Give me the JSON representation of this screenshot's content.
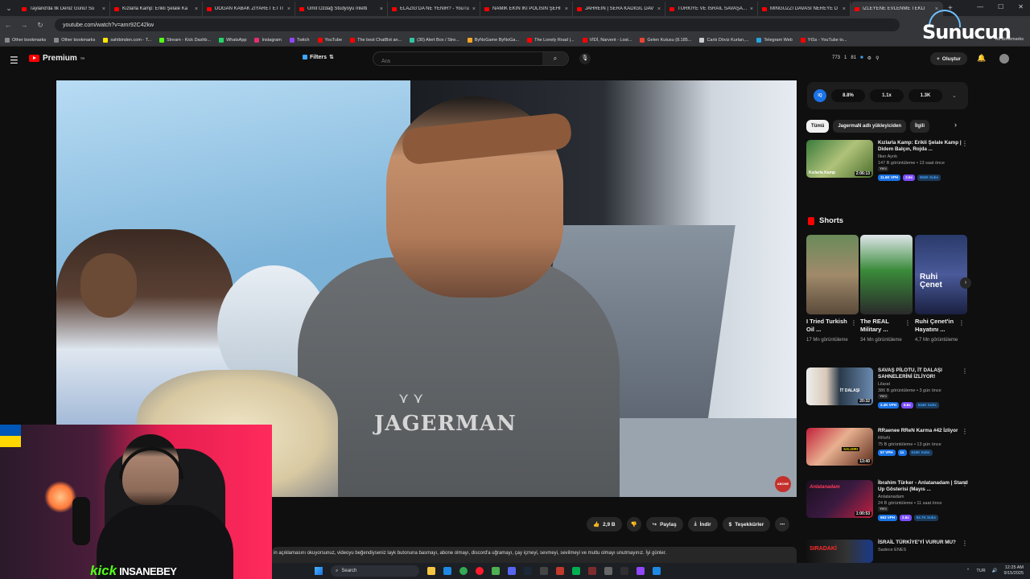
{
  "browser": {
    "tabs": [
      {
        "title": "Tayland'da İlk Deniz Günü! Su"
      },
      {
        "title": "Kızlarla Kamp: Erikli Şelale Ka"
      },
      {
        "title": "DOĞAN KABAK ZİYARET ETTİ"
      },
      {
        "title": "Ümit Özdağ Stüdyoyu İnletti"
      },
      {
        "title": "ELAZIĞ'DA NE YENİR? - YouTu"
      },
      {
        "title": "NAMIK EKİN İKİ POLİSİN ŞEHİ"
      },
      {
        "title": "JAHREIN | SERA KADIGİL DAV"
      },
      {
        "title": "TÜRKİYE VE İSRAİL SAVAŞA M"
      },
      {
        "title": "MİNGUZZİ DAVASI NEREYE D"
      },
      {
        "title": "İZLEYENE EVLENME TEKLİ",
        "active": true
      }
    ],
    "url": "youtube.com/watch?v=amr92C42kw",
    "bookmarks": [
      {
        "label": "Other bookmarks",
        "color": "#888888"
      },
      {
        "label": "Other bookmarks",
        "color": "#888888"
      },
      {
        "label": "sahibinden.com - T...",
        "color": "#ffe600"
      },
      {
        "label": "Stream - Kick Dashb...",
        "color": "#53fc18"
      },
      {
        "label": "WhatsApp",
        "color": "#25d366"
      },
      {
        "label": "Instagram",
        "color": "#e1306c"
      },
      {
        "label": "Twitch",
        "color": "#9146ff"
      },
      {
        "label": "YouTube",
        "color": "#ff0000"
      },
      {
        "label": "The best ChatBot an...",
        "color": "#ff0000"
      },
      {
        "label": "(30) Alert Box / Stre...",
        "color": "#31c3a2"
      },
      {
        "label": "ByNoGame ByNoGa...",
        "color": "#f5a623"
      },
      {
        "label": "The Lonely Road |...",
        "color": "#ff0000"
      },
      {
        "label": "VİDİ, Narvent - Lost...",
        "color": "#ff0000"
      },
      {
        "label": "Gelen Kutusu (8.185...",
        "color": "#ea4335"
      },
      {
        "label": "Canlı Döviz Kurları,...",
        "color": "#cccccc"
      },
      {
        "label": "Telegram Web",
        "color": "#2aa3de"
      },
      {
        "label": "YtSs - YouTube to...",
        "color": "#ff0000"
      }
    ],
    "all_bookmarks": "All Bookmarks"
  },
  "youtube": {
    "logo": "Premium",
    "logo_sup": "TR",
    "filters": "Filters",
    "search_placeholder": "Ara",
    "stats": [
      "773",
      "1",
      "81"
    ],
    "create": "Oluştur"
  },
  "video": {
    "brand": "JAGERMAN",
    "subscribe_badge": "ABONE OL"
  },
  "overlay": {
    "platform": "kick",
    "streamer": "INSANEBEY"
  },
  "actions": {
    "likes": "2,9 B",
    "share": "Paylaş",
    "download": "İndir",
    "thanks": "Teşekkürler"
  },
  "description": "in açıklamasını okuyorsunuz, videoyu beğendiyseniz layk butonuna basmayı, abone olmayı, discord'a uğramayı, çay içmeyi, sevmeyi, sevilmeyi ve mutlu olmayı unutmayınız. İyi günler.",
  "extension": {
    "logo": "IQ",
    "chips": [
      "8.8%",
      "1.1x",
      "1.3K"
    ]
  },
  "sidebar": {
    "chips": [
      "Tümü",
      "JagermaN adlı yükleyiciden",
      "İlgili"
    ],
    "videos_top": [
      {
        "title": "Kızlarla Kamp: Erikli Şelale Kamp | Didem Balçın, Rojda ...",
        "channel": "İlker Ayrık",
        "meta": "147 B görüntüleme • 13 saat önce",
        "new": "Yeni",
        "duration": "2:06:13",
        "b1": "11.6K VPH",
        "b2": "2.6x",
        "b3": "504K Subs",
        "thumb_text": "Kızlarla Kamp"
      }
    ],
    "shorts_title": "Shorts",
    "shorts": [
      {
        "title": "I Tried Turkish Oil ...",
        "views": "17 Mn görüntüleme"
      },
      {
        "title": "The REAL Military ...",
        "views": "34 Mn görüntüleme"
      },
      {
        "title": "Ruhi Çenet'in Hayatını ...",
        "views": "4,7 Mn görüntüleme",
        "thumb_text": "Ruhi Çenet"
      }
    ],
    "videos_bottom": [
      {
        "title": "SAVAŞ PİLOTU, İT DALAŞI SAHNELERİNİ İZLİYOR!",
        "channel": "Lilarat",
        "meta": "386 B görüntüleme • 3 gün önce",
        "new": "Yeni",
        "duration": "20:32",
        "b1": "2.4K VPH",
        "b2": "6.6x",
        "b3": "544K Subs",
        "thumb_text": "İT DALAŞI"
      },
      {
        "title": "RRaenee RReN Karma #42 İzliyor",
        "channel": "RReN",
        "meta": "75 B görüntüleme • 13 gün önce",
        "new": "",
        "duration": "13:40",
        "b1": "57 VPH",
        "b2": "1x",
        "b3": "616K Subs",
        "thumb_text": "SALDIRI"
      },
      {
        "title": "İbrahim Türker - Anlatanadam | Stand Up Gösterisi (Mayıs ...",
        "channel": "Anlatanadam",
        "meta": "24 B görüntüleme • 11 saat önce",
        "new": "Yeni",
        "duration": "1:00:53",
        "b1": "663 VPH",
        "b2": "2.6x",
        "b3": "52.7K Subs",
        "thumb_text": "Anlatanadam"
      },
      {
        "title": "İSRAİL TÜRKİYE'Yİ VURUR MU?",
        "channel": "Sadece ENES",
        "meta": "",
        "new": "",
        "duration": "",
        "b1": "",
        "b2": "",
        "b3": "",
        "thumb_text": "SIRADAKİ"
      }
    ]
  },
  "taskbar": {
    "search": "Search",
    "lang": "TUR",
    "time": "12:25 AM",
    "date": "9/15/2025"
  },
  "watermark": "Sunucun",
  "colors": {
    "youtube_red": "#ff0000",
    "kick_green": "#53fc18",
    "vph_blue": "#1a73e8",
    "ratio_purple": "#7b4dff",
    "subs_blue": "#3ea6ff"
  }
}
